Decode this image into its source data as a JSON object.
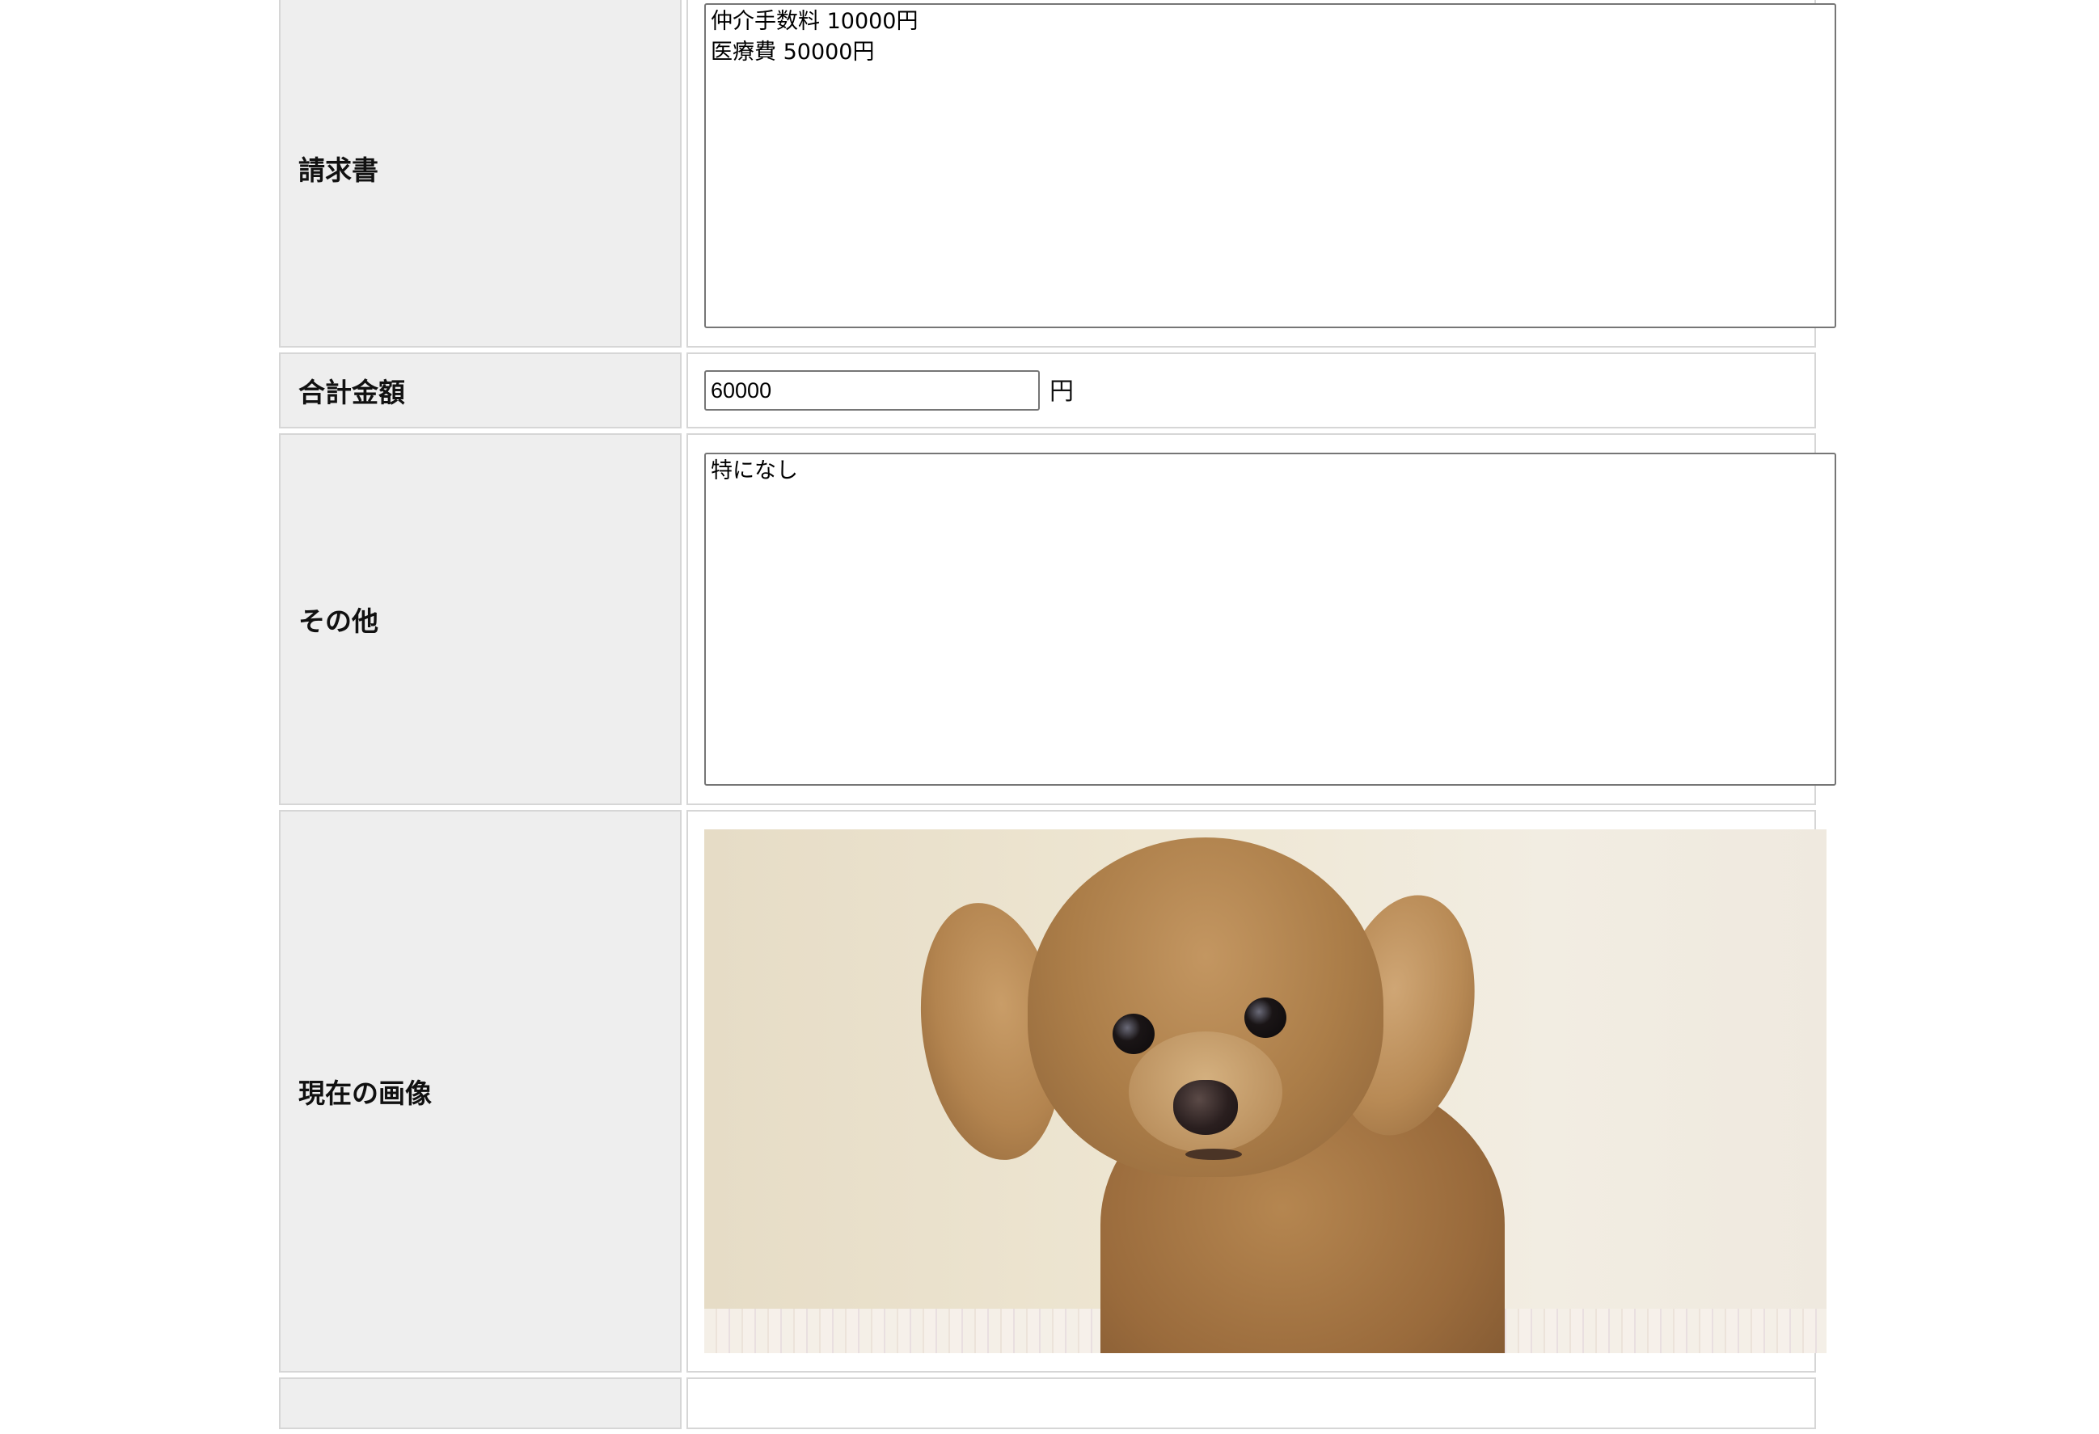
{
  "form": {
    "rows": {
      "invoice": {
        "label": "請求書",
        "value": "仲介手数料 10000円\n医療費 50000円"
      },
      "total": {
        "label": "合計金額",
        "value": "60000",
        "unit": "円"
      },
      "other": {
        "label": "その他",
        "value": "特になし"
      },
      "current_image": {
        "label": "現在の画像",
        "image_subject": "toy poodle puppy photo"
      }
    }
  },
  "colors": {
    "label_bg": "#eeeeee",
    "cell_border": "#d6d6d6",
    "input_border": "#767676"
  }
}
